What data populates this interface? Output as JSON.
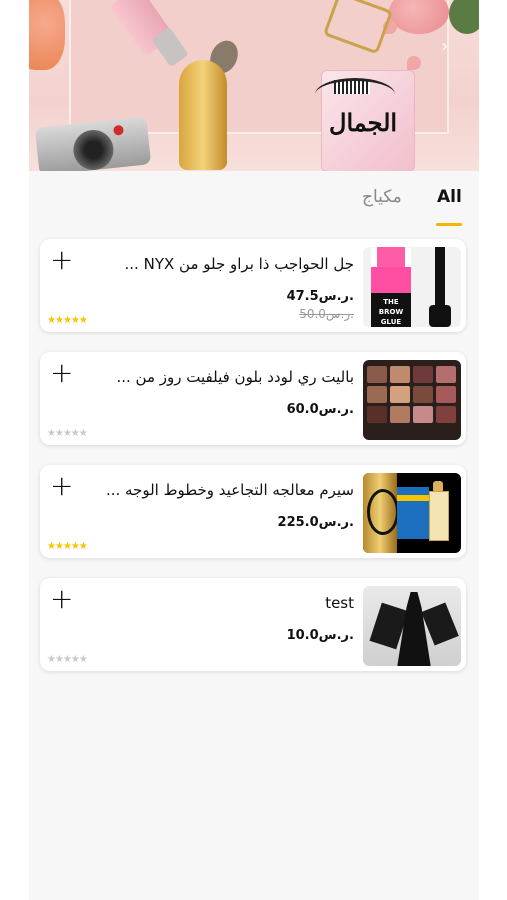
{
  "banner": {
    "title_ar": "الجمال",
    "chevron": "›",
    "chevron_icon": "chevron-right-icon"
  },
  "tabs": [
    {
      "label": "All",
      "active": true
    },
    {
      "label": "مكياج",
      "active": false
    }
  ],
  "colors": {
    "accent": "#f5b400",
    "star_on": "#f5c400",
    "star_off": "#c9c9c9"
  },
  "products": [
    {
      "title": "جل الحواجب ذا براو جلو من NYX ...",
      "price": "47.5ر.س.",
      "old_price": "50.0ر.س.",
      "rating": 5,
      "image_icon": "nyx-brow-glue-product-image",
      "nyx_label": "THE BROW GLUE"
    },
    {
      "title": "باليت ري لودد بلون فيلفيت روز من ...",
      "price": "60.0ر.س.",
      "old_price": "",
      "rating": 0,
      "image_icon": "eyeshadow-palette-product-image"
    },
    {
      "title": "سيرم معالجه التجاعيد وخطوط الوجه ...",
      "price": "225.0ر.س.",
      "old_price": "",
      "rating": 5,
      "image_icon": "serum-box-product-image"
    },
    {
      "title": "test",
      "price": "10.0ر.س.",
      "old_price": "",
      "rating": 0,
      "image_icon": "abaya-product-image"
    }
  ],
  "add_button": "+"
}
